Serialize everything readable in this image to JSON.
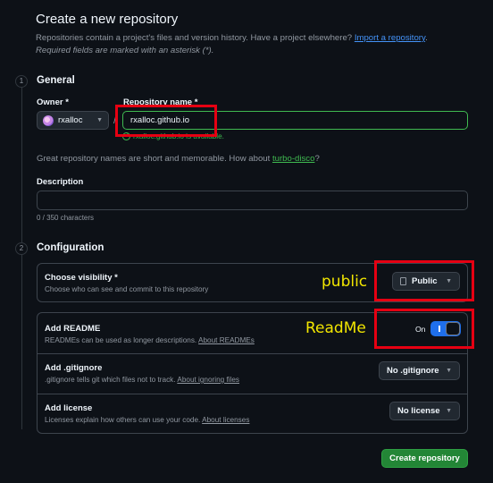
{
  "header": {
    "title": "Create a new repository",
    "intro_text": "Repositories contain a project's files and version history. Have a project elsewhere?",
    "import_link": "Import a repository",
    "intro_period": ".",
    "required_note": "Required fields are marked with an asterisk (*)."
  },
  "general": {
    "step": "1",
    "title": "General",
    "owner_label": "Owner *",
    "owner_value": "rxalloc",
    "repo_label": "Repository name *",
    "slash": "/",
    "repo_value": "rxalloc.github.io",
    "availability": "rxalloc.github.io is available.",
    "suggest_text": "Great repository names are short and memorable. How about",
    "suggest_name": "turbo-disco",
    "suggest_q": "?",
    "description_label": "Description",
    "description_value": "",
    "char_count": "0 / 350 characters"
  },
  "configuration": {
    "step": "2",
    "title": "Configuration",
    "visibility": {
      "title": "Choose visibility *",
      "subtitle": "Choose who can see and commit to this repository",
      "value": "Public"
    },
    "readme": {
      "title": "Add README",
      "subtitle": "READMEs can be used as longer descriptions.",
      "link": "About READMEs",
      "toggle_label": "On"
    },
    "gitignore": {
      "title": "Add .gitignore",
      "subtitle": ".gitignore tells git which files not to track.",
      "link": "About ignoring files",
      "value": "No .gitignore"
    },
    "license": {
      "title": "Add license",
      "subtitle": "Licenses explain how others can use your code.",
      "link": "About licenses",
      "value": "No license"
    }
  },
  "annotations": {
    "public": "public",
    "readme": "ReadMe"
  },
  "actions": {
    "create_label": "Create repository"
  },
  "colors": {
    "background": "#0d1117",
    "accent_green": "#238636",
    "valid_green": "#3fb950",
    "toggle_blue": "#1f6feb",
    "annotation_red": "#e60012",
    "annotation_yellow": "#f2e600"
  }
}
